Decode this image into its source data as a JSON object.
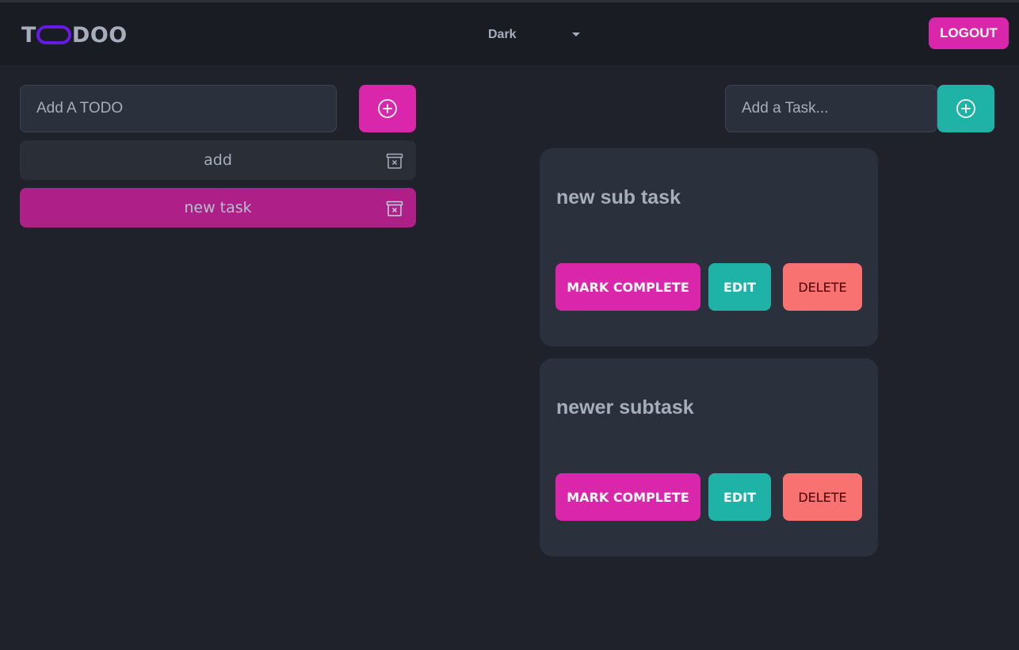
{
  "header": {
    "logo_text_left": "T",
    "logo_text_right": "DOO",
    "theme_selected": "Dark",
    "logout_label": "LOGOUT"
  },
  "todos": {
    "input_placeholder": "Add A TODO",
    "items": [
      {
        "label": "add"
      },
      {
        "label": "new task"
      }
    ]
  },
  "tasks": {
    "input_placeholder": "Add a Task...",
    "cards": [
      {
        "title": "new sub task",
        "complete_label": "MARK COMPLETE",
        "edit_label": "EDIT",
        "delete_label": "DELETE"
      },
      {
        "title": "newer subtask",
        "complete_label": "MARK COMPLETE",
        "edit_label": "EDIT",
        "delete_label": "DELETE"
      }
    ]
  },
  "colors": {
    "primary": "#d926aa",
    "secondary": "#1fb2a6",
    "error": "#f87272",
    "logo_accent": "#661ae6",
    "background": "#1f222b"
  },
  "icons": {
    "add_todo": "plus-circle-icon",
    "add_task": "plus-circle-icon",
    "todo_delete": "archive-x-icon",
    "theme_caret": "caret-down-icon"
  }
}
